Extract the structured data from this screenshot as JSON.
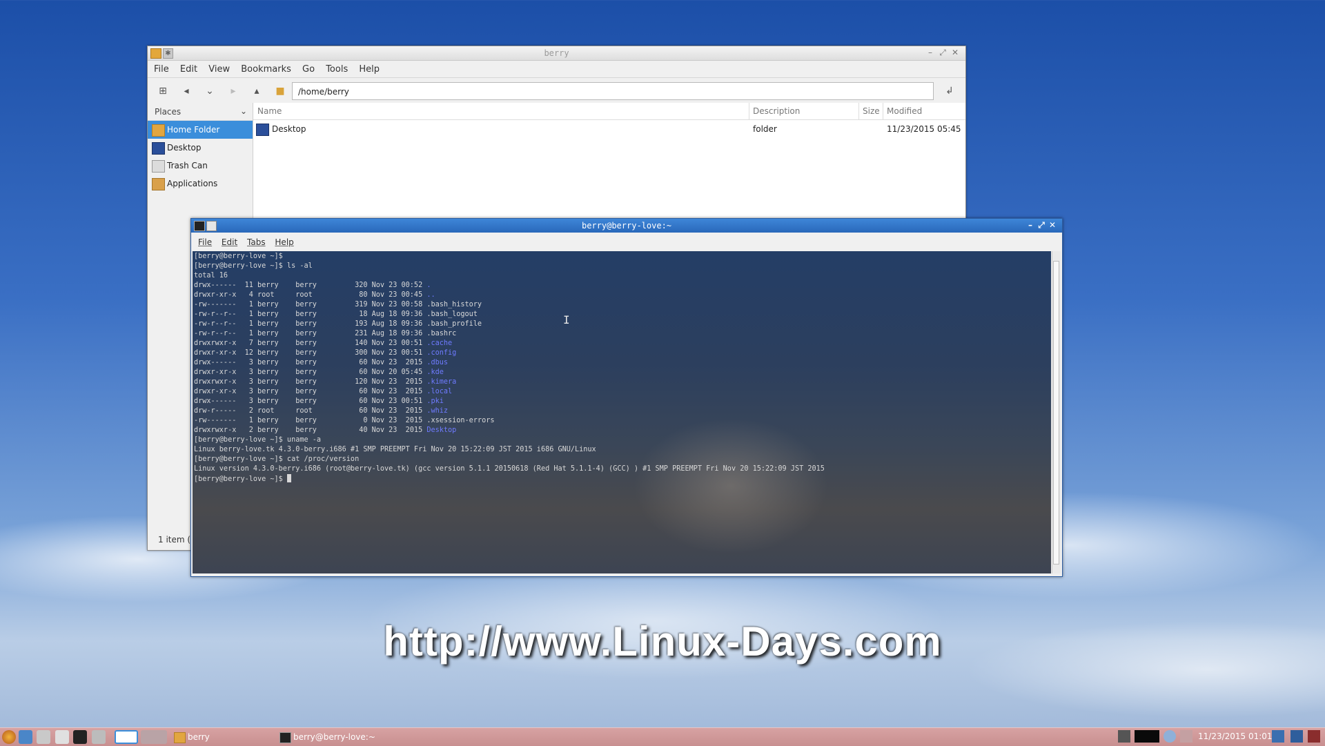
{
  "desktop": {
    "watermark": "http://www.Linux-Days.com"
  },
  "file_manager": {
    "title": "berry",
    "menu": [
      "File",
      "Edit",
      "View",
      "Bookmarks",
      "Go",
      "Tools",
      "Help"
    ],
    "path": "/home/berry",
    "places_label": "Places",
    "places": [
      {
        "label": "Home Folder",
        "icon": "home-folder-icon",
        "selected": true
      },
      {
        "label": "Desktop",
        "icon": "desktop-icon",
        "selected": false
      },
      {
        "label": "Trash Can",
        "icon": "trash-icon",
        "selected": false
      },
      {
        "label": "Applications",
        "icon": "applications-icon",
        "selected": false
      }
    ],
    "columns": {
      "name": "Name",
      "description": "Description",
      "size": "Size",
      "modified": "Modified"
    },
    "files": [
      {
        "name": "Desktop",
        "description": "folder",
        "size": "",
        "modified": "11/23/2015 05:45"
      }
    ],
    "status": "1 item ("
  },
  "terminal": {
    "title": "berry@berry-love:~",
    "menu": [
      "File",
      "Edit",
      "Tabs",
      "Help"
    ],
    "lines": [
      {
        "text": "[berry@berry-love ~]$"
      },
      {
        "text": "[berry@berry-love ~]$ ls -al"
      },
      {
        "text": "total 16"
      },
      {
        "text": "drwx------  11 berry    berry         320 Nov 23 00:52 ",
        "dir": "."
      },
      {
        "text": "drwxr-xr-x   4 root     root           80 Nov 23 00:45 ",
        "dir": ".."
      },
      {
        "text": "-rw-------   1 berry    berry         319 Nov 23 00:58 .bash_history"
      },
      {
        "text": "-rw-r--r--   1 berry    berry          18 Aug 18 09:36 .bash_logout"
      },
      {
        "text": "-rw-r--r--   1 berry    berry         193 Aug 18 09:36 .bash_profile"
      },
      {
        "text": "-rw-r--r--   1 berry    berry         231 Aug 18 09:36 .bashrc"
      },
      {
        "text": "drwxrwxr-x   7 berry    berry         140 Nov 23 00:51 ",
        "dir": ".cache"
      },
      {
        "text": "drwxr-xr-x  12 berry    berry         300 Nov 23 00:51 ",
        "dir": ".config"
      },
      {
        "text": "drwx------   3 berry    berry          60 Nov 23  2015 ",
        "dir": ".dbus"
      },
      {
        "text": "drwxr-xr-x   3 berry    berry          60 Nov 20 05:45 ",
        "dir": ".kde"
      },
      {
        "text": "drwxrwxr-x   3 berry    berry         120 Nov 23  2015 ",
        "dir": ".kimera"
      },
      {
        "text": "drwxr-xr-x   3 berry    berry          60 Nov 23  2015 ",
        "dir": ".local"
      },
      {
        "text": "drwx------   3 berry    berry          60 Nov 23 00:51 ",
        "dir": ".pki"
      },
      {
        "text": "drw-r-----   2 root     root           60 Nov 23  2015 ",
        "dir": ".whiz"
      },
      {
        "text": "-rw-------   1 berry    berry           0 Nov 23  2015 .xsession-errors"
      },
      {
        "text": "drwxrwxr-x   2 berry    berry          40 Nov 23  2015 ",
        "dir": "Desktop"
      },
      {
        "text": "[berry@berry-love ~]$ uname -a"
      },
      {
        "text": "Linux berry-love.tk 4.3.0-berry.i686 #1 SMP PREEMPT Fri Nov 20 15:22:09 JST 2015 i686 GNU/Linux"
      },
      {
        "text": "[berry@berry-love ~]$ cat /proc/version"
      },
      {
        "text": "Linux version 4.3.0-berry.i686 (root@berry-love.tk) (gcc version 5.1.1 20150618 (Red Hat 5.1.1-4) (GCC) ) #1 SMP PREEMPT Fri Nov 20 15:22:09 JST 2015"
      },
      {
        "text": "[berry@berry-love ~]$ ",
        "cursor": true
      }
    ]
  },
  "taskbar": {
    "tasks": [
      {
        "label": "berry",
        "icon": "folder-icon"
      },
      {
        "label": "berry@berry-love:~",
        "icon": "terminal-icon"
      }
    ],
    "clock": "11/23/2015 01:01"
  },
  "colors": {
    "selection": "#3b8edb",
    "terminal_dir": "#6f7bff",
    "taskbar": "#c88f90",
    "terminal_titlebar": "#2a68ba"
  }
}
